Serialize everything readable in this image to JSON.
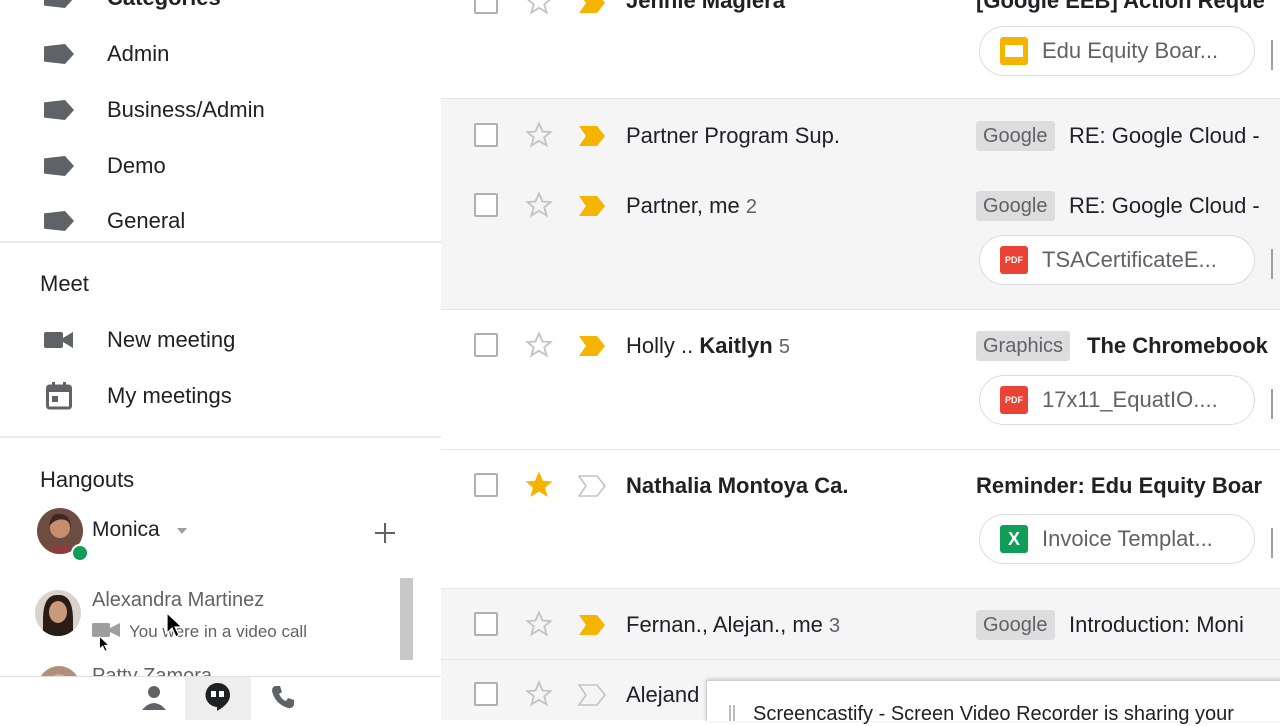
{
  "sidebar": {
    "categories_label": "Categories",
    "labels": [
      {
        "label": "Admin",
        "icon": "label-icon"
      },
      {
        "label": "Business/Admin",
        "icon": "label-icon"
      },
      {
        "label": "Demo",
        "icon": "label-icon"
      },
      {
        "label": "General",
        "icon": "label-icon"
      }
    ],
    "meet": {
      "title": "Meet",
      "items": [
        {
          "label": "New meeting",
          "icon": "video-camera-icon"
        },
        {
          "label": "My meetings",
          "icon": "calendar-icon"
        }
      ]
    },
    "hangouts": {
      "title": "Hangouts",
      "user": {
        "name": "Monica",
        "status": "online"
      },
      "add_icon": "plus-icon",
      "contacts": [
        {
          "name": "Alexandra Martinez",
          "status_text": "You were in a video call"
        },
        {
          "name": "Patty Zamora",
          "status_text": ""
        }
      ]
    },
    "bottom_tabs": [
      {
        "name": "contacts",
        "icon": "person-icon"
      },
      {
        "name": "conversations",
        "icon": "hangouts-icon",
        "active": true
      },
      {
        "name": "calls",
        "icon": "phone-icon"
      }
    ]
  },
  "mail": {
    "rows": [
      {
        "sender": "Jennie Magiera",
        "count": "",
        "starred": false,
        "important": true,
        "tag": "",
        "subject": "[Google EEB] Action Reque",
        "attachment": {
          "name": "Edu Equity Boar...",
          "type": "slides",
          "color": "#f4b400"
        },
        "read": false
      },
      {
        "sender": "Partner Program Sup.",
        "count": "",
        "starred": false,
        "important": true,
        "tag": "Google",
        "subject": "RE: Google Cloud -",
        "attachment": null,
        "read": true
      },
      {
        "sender": "Partner, me",
        "count": "2",
        "starred": false,
        "important": true,
        "tag": "Google",
        "subject": "RE: Google Cloud -",
        "attachment": {
          "name": "TSACertificateE...",
          "type": "pdf",
          "color": "#ea4335"
        },
        "read": true
      },
      {
        "sender_pre": "Holly .. ",
        "sender_bold": "Kaitlyn",
        "count": "5",
        "starred": false,
        "important": true,
        "tag": "Graphics",
        "subject": "The Chromebook",
        "attachment": {
          "name": "17x11_EquatIO....",
          "type": "pdf",
          "color": "#ea4335"
        },
        "read": false
      },
      {
        "sender": "Nathalia Montoya Ca.",
        "count": "",
        "starred": true,
        "important": false,
        "tag": "",
        "subject": "Reminder: Edu Equity Boar",
        "attachment": {
          "name": "Invoice Templat...",
          "type": "sheets",
          "color": "#0f9d58"
        },
        "read": false
      },
      {
        "sender": "Fernan., Alejan., me",
        "count": "3",
        "starred": false,
        "important": true,
        "tag": "Google",
        "subject": "Introduction: Moni",
        "attachment": null,
        "read": true
      },
      {
        "sender": "Alejand",
        "count": "",
        "starred": false,
        "important": false,
        "tag": "",
        "subject": "",
        "attachment": null,
        "read": true
      }
    ],
    "pdf_label": "PDF",
    "sheets_label": "X"
  },
  "toast": {
    "text": "Screencastify - Screen Video Recorder is sharing your"
  },
  "colors": {
    "important": "#f4b400",
    "star": "#f4b400",
    "online": "#0f9d58",
    "grey_icon": "#5f6368"
  }
}
